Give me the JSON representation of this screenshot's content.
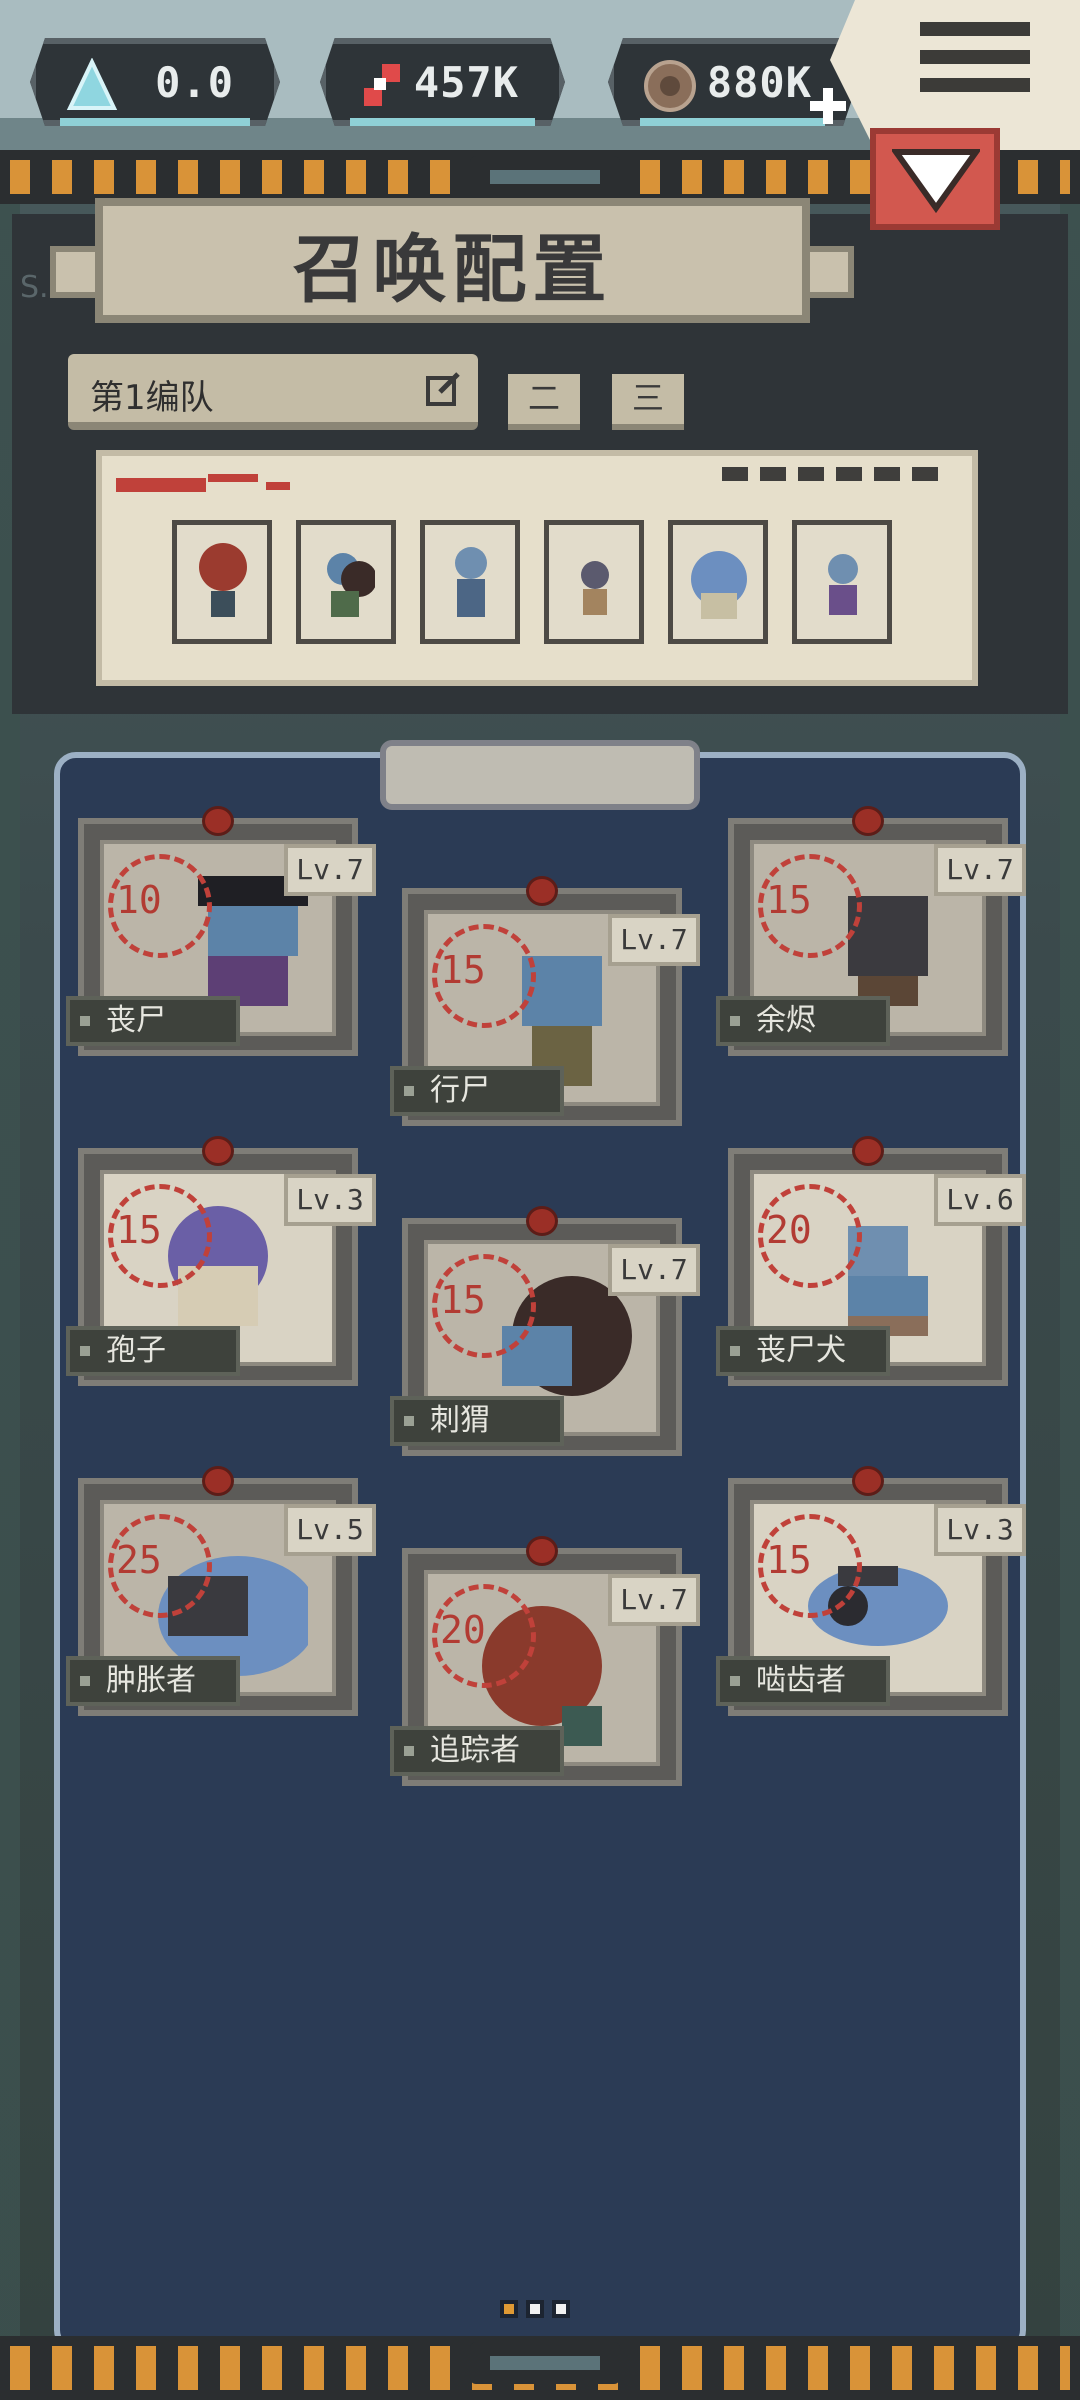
{
  "resources": [
    {
      "icon": "crystal-icon",
      "value": "0.0"
    },
    {
      "icon": "gene-icon",
      "value": "457K"
    },
    {
      "icon": "coin-icon",
      "value": "880K"
    }
  ],
  "title": "召唤配置",
  "team": {
    "current": "第1编队",
    "tabs": [
      "二",
      "三"
    ]
  },
  "cards": [
    {
      "name": "丧尸",
      "level": "Lv.7",
      "cost": "10"
    },
    {
      "name": "行尸",
      "level": "Lv.7",
      "cost": "15"
    },
    {
      "name": "余烬",
      "level": "Lv.7",
      "cost": "15"
    },
    {
      "name": "孢子",
      "level": "Lv.3",
      "cost": "15"
    },
    {
      "name": "刺猬",
      "level": "Lv.7",
      "cost": "15"
    },
    {
      "name": "丧尸犬",
      "level": "Lv.6",
      "cost": "20"
    },
    {
      "name": "肿胀者",
      "level": "Lv.5",
      "cost": "25"
    },
    {
      "name": "追踪者",
      "level": "Lv.7",
      "cost": "20"
    },
    {
      "name": "啮齿者",
      "level": "Lv.3",
      "cost": "15"
    }
  ],
  "colors": {
    "accent": "#d99338",
    "board": "#2b3b55",
    "cost": "#b23b33"
  }
}
